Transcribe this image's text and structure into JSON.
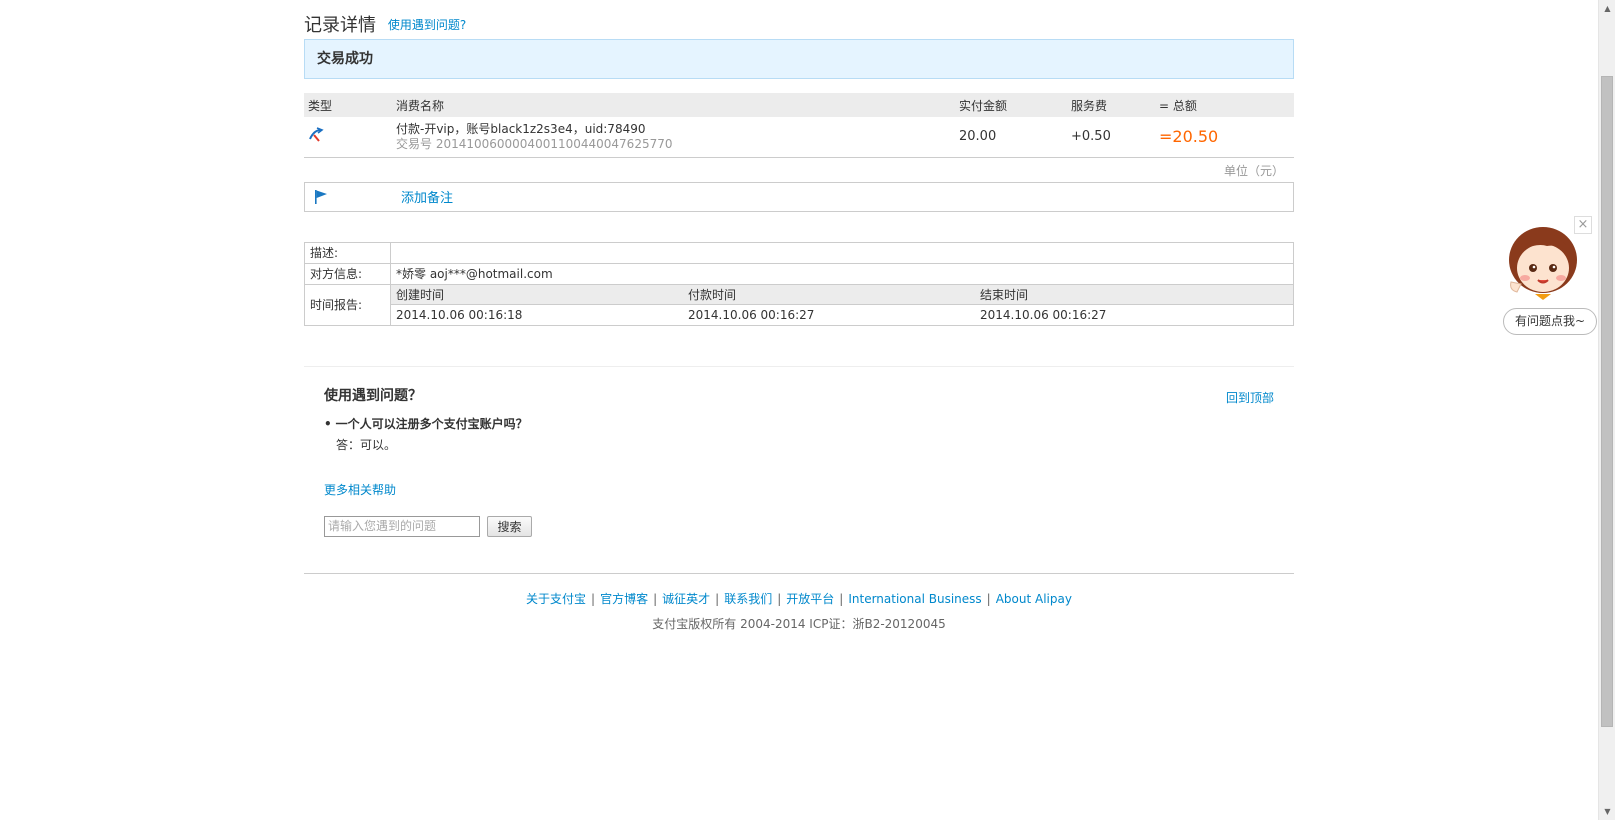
{
  "header": {
    "title": "记录详情",
    "help_link": "使用遇到问题?"
  },
  "status": "交易成功",
  "detail": {
    "columns": [
      "类型",
      "消费名称",
      "实付金额",
      "服务费",
      "= 总额"
    ],
    "type_icon": "alipay-transfer-icon",
    "name": "付款-开vip，账号black1z2s3e4，uid:78490",
    "trade_no": "交易号 2014100600004001100440047625770",
    "paid": "20.00",
    "fee": "+0.50",
    "total": "=20.50"
  },
  "unit": "单位（元）",
  "memo": {
    "icon": "flag-icon",
    "label": "添加备注"
  },
  "info": {
    "desc_label": "描述:",
    "desc_value": "",
    "party_label": "对方信息:",
    "party_value": "*娇零 aoj***@hotmail.com",
    "time_label": "时间报告:",
    "time_headers": [
      "创建时间",
      "付款时间",
      "结束时间"
    ],
    "time_values": [
      "2014.10.06 00:16:18",
      "2014.10.06 00:16:27",
      "2014.10.06 00:16:27"
    ]
  },
  "help": {
    "title": "使用遇到问题？",
    "back_top": "回到顶部",
    "question": "一个人可以注册多个支付宝账户吗？",
    "answer": "答：可以。",
    "more": "更多相关帮助",
    "search_placeholder": "请输入您遇到的问题",
    "search_button": "搜索"
  },
  "footer": {
    "links": [
      "关于支付宝",
      "官方博客",
      "诚征英才",
      "联系我们",
      "开放平台",
      "International Business",
      "About Alipay"
    ],
    "copyright": "支付宝版权所有 2004-2014 ICP证：浙B2-20120045"
  },
  "helper": {
    "close": "×",
    "bubble": "有问题点我~"
  },
  "colors": {
    "link": "#0088cc",
    "total": "#ff6600",
    "status_bg": "#e5f4ff"
  }
}
